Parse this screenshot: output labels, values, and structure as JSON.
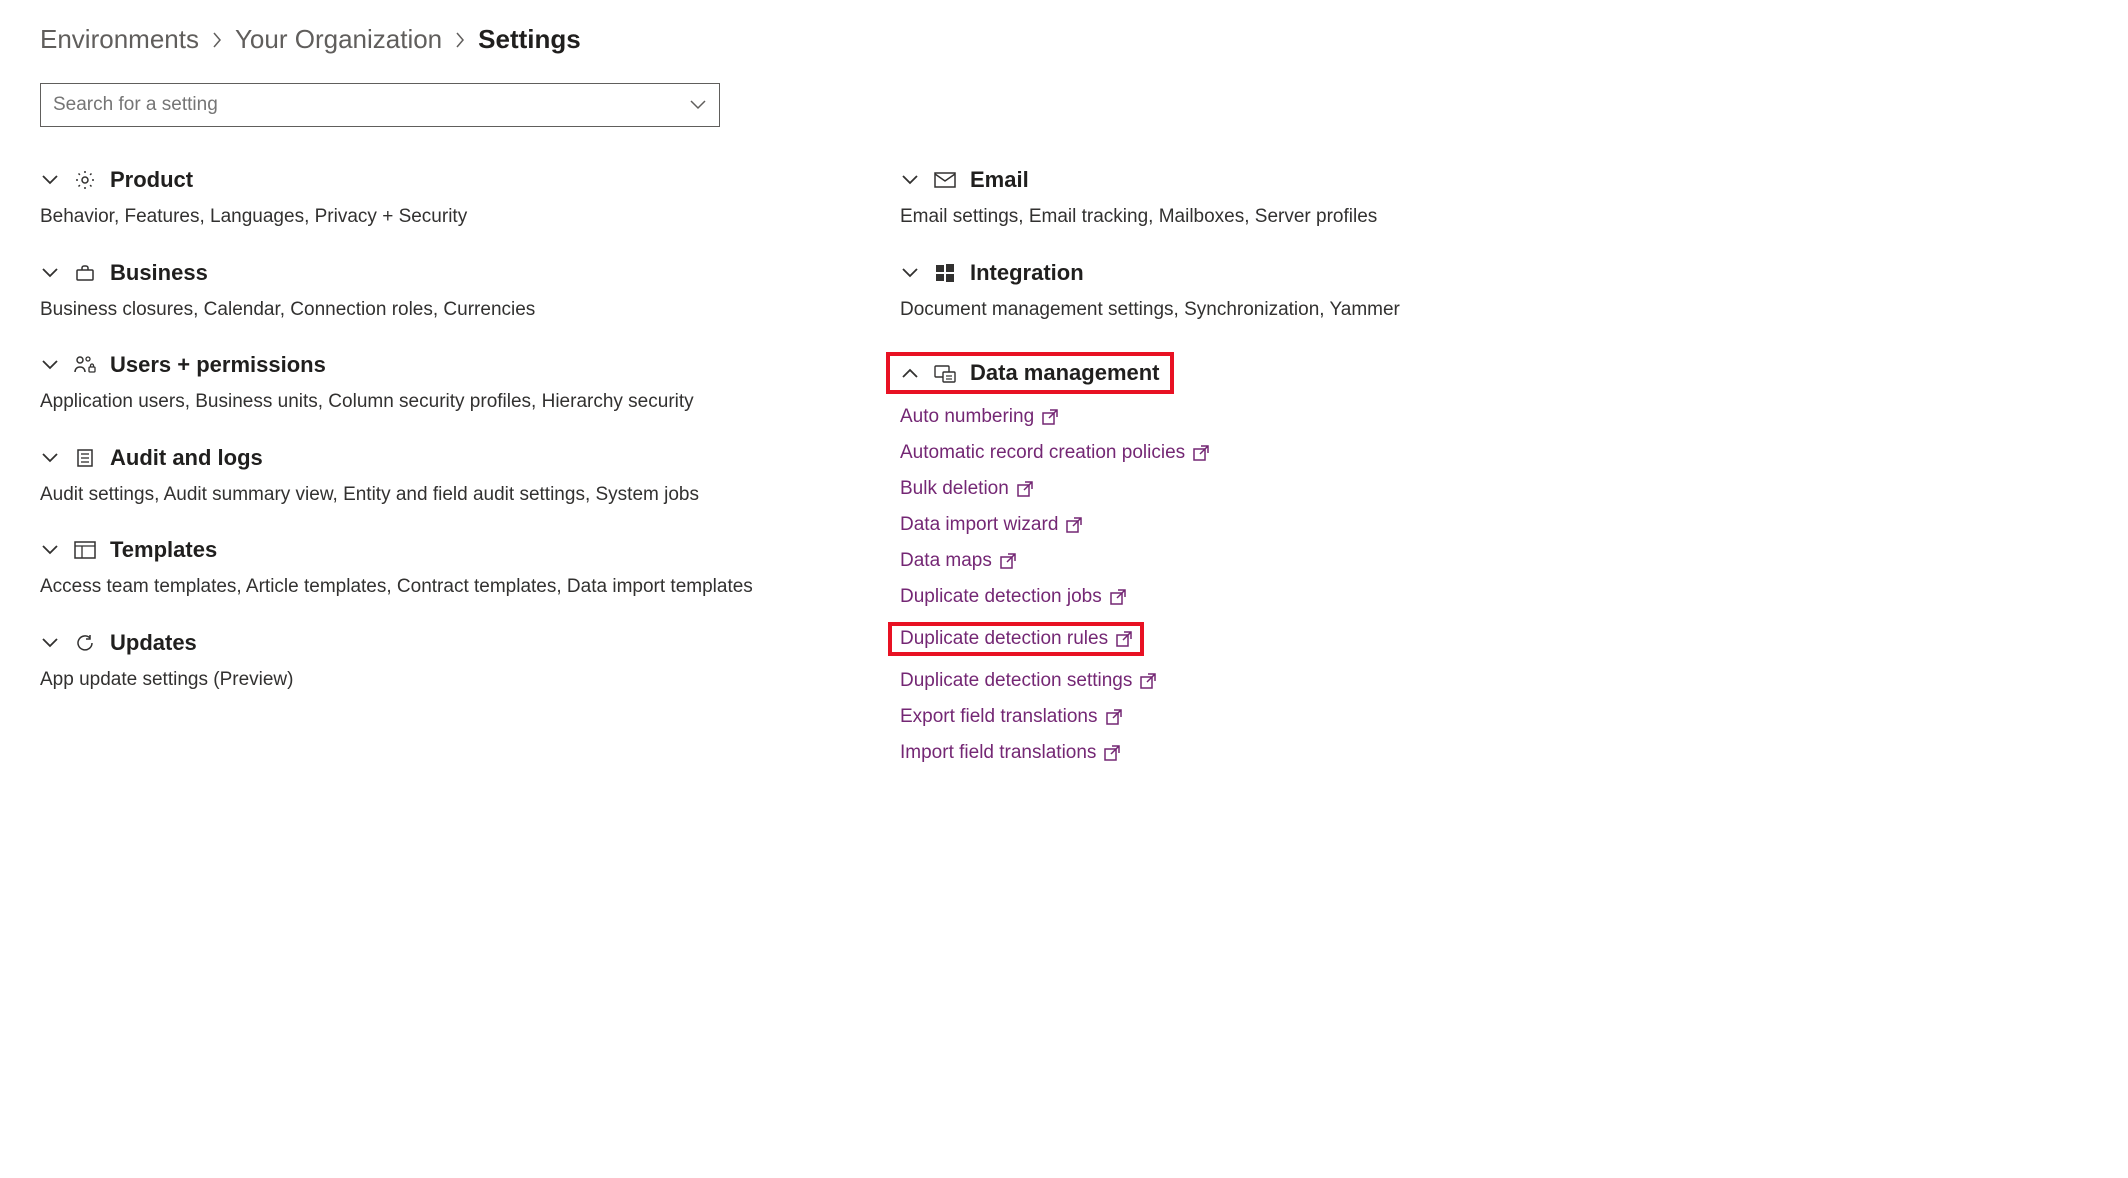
{
  "breadcrumb": {
    "items": [
      "Environments",
      "Your Organization",
      "Settings"
    ]
  },
  "search": {
    "placeholder": "Search for a setting"
  },
  "left": {
    "product": {
      "title": "Product",
      "desc": "Behavior, Features, Languages, Privacy + Security"
    },
    "business": {
      "title": "Business",
      "desc": "Business closures, Calendar, Connection roles, Currencies"
    },
    "users": {
      "title": "Users + permissions",
      "desc": "Application users, Business units, Column security profiles, Hierarchy security"
    },
    "audit": {
      "title": "Audit and logs",
      "desc": "Audit settings, Audit summary view, Entity and field audit settings, System jobs"
    },
    "templates": {
      "title": "Templates",
      "desc": "Access team templates, Article templates, Contract templates, Data import templates"
    },
    "updates": {
      "title": "Updates",
      "desc": "App update settings (Preview)"
    }
  },
  "right": {
    "email": {
      "title": "Email",
      "desc": "Email settings, Email tracking, Mailboxes, Server profiles"
    },
    "integration": {
      "title": "Integration",
      "desc": "Document management settings, Synchronization, Yammer"
    },
    "datamgmt": {
      "title": "Data management",
      "links": [
        "Auto numbering",
        "Automatic record creation policies",
        "Bulk deletion",
        "Data import wizard",
        "Data maps",
        "Duplicate detection jobs",
        "Duplicate detection rules",
        "Duplicate detection settings",
        "Export field translations",
        "Import field translations"
      ]
    }
  }
}
